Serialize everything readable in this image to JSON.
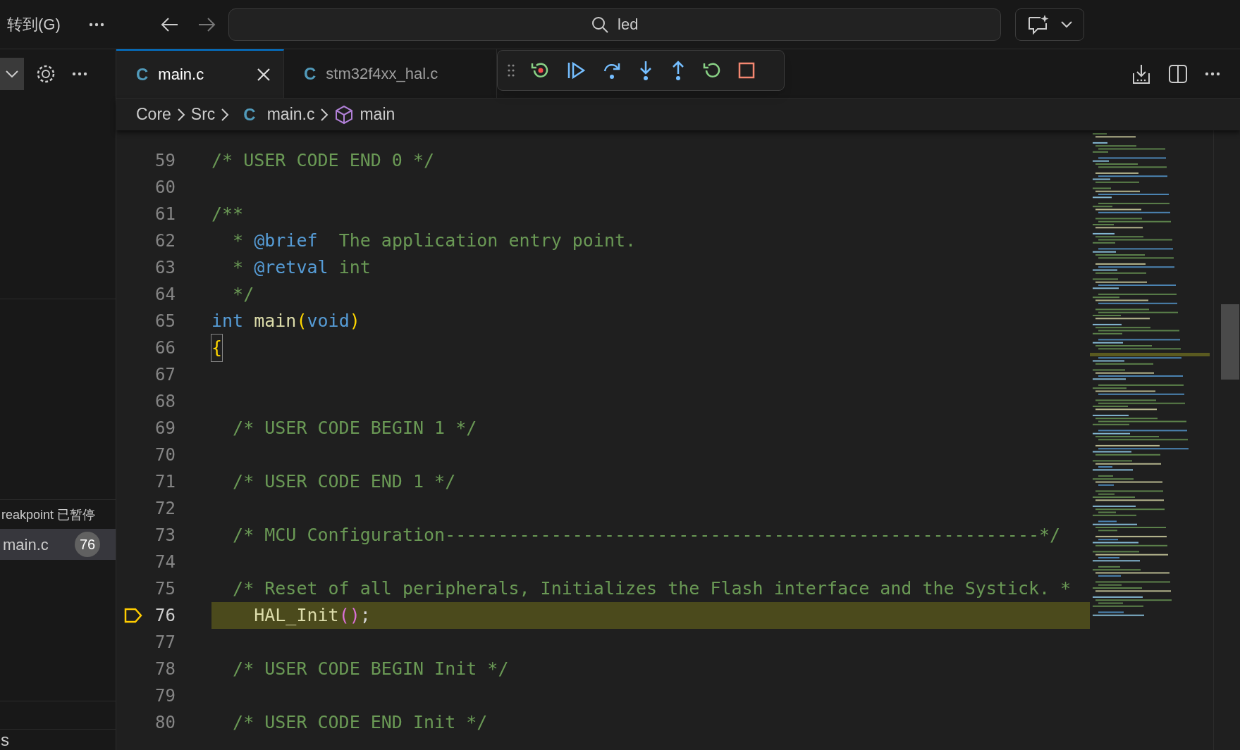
{
  "title_bar": {
    "menu_label": "转到(G)",
    "search": {
      "value": "led"
    }
  },
  "sidebar": {
    "status": "reakpoint 已暂停",
    "frames": [
      {
        "file": "main.c",
        "line": "76",
        "selected": true
      }
    ],
    "footer_text": "s"
  },
  "tabs": [
    {
      "icon_text": "C",
      "label": "main.c",
      "selected": true
    },
    {
      "icon_text": "C",
      "label": "stm32f4xx_hal.c",
      "selected": false
    }
  ],
  "breadcrumb": [
    {
      "kind": "folder",
      "label": "Core"
    },
    {
      "kind": "folder",
      "label": "Src"
    },
    {
      "kind": "file",
      "icon_text": "C",
      "label": "main.c"
    },
    {
      "kind": "symbol",
      "label": "main"
    }
  ],
  "code_lines": [
    {
      "number": "59",
      "current": false,
      "segments": [
        {
          "kind": "comment",
          "text": "/* USER CODE END 0 */"
        }
      ]
    },
    {
      "number": "60",
      "current": false
    },
    {
      "number": "61",
      "current": false,
      "segments": [
        {
          "kind": "comment",
          "text": "/**"
        }
      ]
    },
    {
      "number": "62",
      "current": false,
      "segments": [
        {
          "kind": "comment",
          "text": "  * "
        },
        {
          "kind": "doc-tag",
          "text": "@brief"
        },
        {
          "kind": "comment",
          "text": "  The application entry point."
        }
      ]
    },
    {
      "number": "63",
      "current": false,
      "segments": [
        {
          "kind": "comment",
          "text": "  * "
        },
        {
          "kind": "doc-tag",
          "text": "@retval"
        },
        {
          "kind": "comment",
          "text": " int"
        }
      ]
    },
    {
      "number": "64",
      "current": false,
      "segments": [
        {
          "kind": "comment",
          "text": "  */"
        }
      ]
    },
    {
      "number": "65",
      "current": false,
      "segments": [
        {
          "kind": "keyword",
          "text": "int"
        },
        {
          "kind": "function",
          "text": " main"
        },
        {
          "kind": "bracket",
          "text": "("
        },
        {
          "kind": "keyword",
          "text": "void"
        },
        {
          "kind": "bracket",
          "text": ")"
        }
      ]
    },
    {
      "number": "66",
      "current": false,
      "segments": [
        {
          "kind": "bracket-match",
          "text": "{"
        }
      ]
    },
    {
      "number": "67",
      "current": false
    },
    {
      "number": "68",
      "current": false
    },
    {
      "number": "69",
      "current": false,
      "segments": [
        {
          "kind": "comment",
          "text": "  /* USER CODE BEGIN 1 */"
        }
      ]
    },
    {
      "number": "70",
      "current": false
    },
    {
      "number": "71",
      "current": false,
      "segments": [
        {
          "kind": "comment",
          "text": "  /* USER CODE END 1 */"
        }
      ]
    },
    {
      "number": "72",
      "current": false
    },
    {
      "number": "73",
      "current": false,
      "segments": [
        {
          "kind": "comment",
          "text": "  /* MCU Configuration--------------------------------------------------------*/"
        }
      ]
    },
    {
      "number": "74",
      "current": false
    },
    {
      "number": "75",
      "current": false,
      "segments": [
        {
          "kind": "comment",
          "text": "  /* Reset of all peripherals, Initializes the Flash interface and the Systick. *"
        }
      ]
    },
    {
      "number": "76",
      "current": true,
      "segments": [
        {
          "kind": "function",
          "text": "    HAL_Init"
        },
        {
          "kind": "bracket2",
          "text": "()"
        },
        {
          "kind": "plain",
          "text": ";"
        }
      ]
    },
    {
      "number": "77",
      "current": false
    },
    {
      "number": "78",
      "current": false,
      "segments": [
        {
          "kind": "comment",
          "text": "  /* USER CODE BEGIN Init */"
        }
      ]
    },
    {
      "number": "79",
      "current": false
    },
    {
      "number": "80",
      "current": false,
      "segments": [
        {
          "kind": "comment",
          "text": "  /* USER CODE END Init */"
        }
      ]
    }
  ]
}
